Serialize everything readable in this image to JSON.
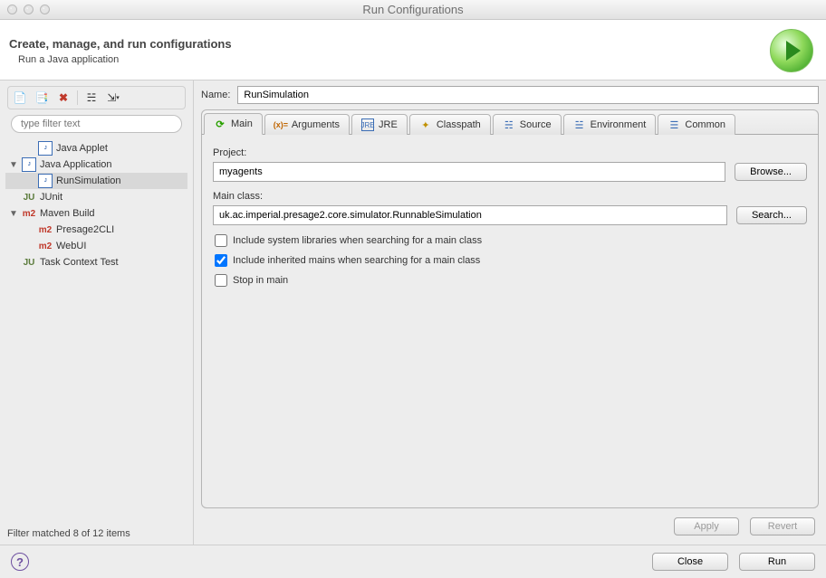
{
  "window": {
    "title": "Run Configurations"
  },
  "header": {
    "title": "Create, manage, and run configurations",
    "subtitle": "Run a Java application"
  },
  "sidebar": {
    "filter_placeholder": "type filter text",
    "status": "Filter matched 8 of 12 items",
    "items": [
      {
        "label": "Java Applet",
        "icon": "java",
        "level": 1,
        "expander": ""
      },
      {
        "label": "Java Application",
        "icon": "java",
        "level": 0,
        "expander": "▼"
      },
      {
        "label": "RunSimulation",
        "icon": "java",
        "level": 1,
        "selected": true,
        "expander": ""
      },
      {
        "label": "JUnit",
        "icon": "junit",
        "level": 0,
        "expander": ""
      },
      {
        "label": "Maven Build",
        "icon": "m2",
        "level": 0,
        "expander": "▼"
      },
      {
        "label": "Presage2CLI",
        "icon": "m2",
        "level": 1,
        "expander": ""
      },
      {
        "label": "WebUI",
        "icon": "m2",
        "level": 1,
        "expander": ""
      },
      {
        "label": "Task Context Test",
        "icon": "junit",
        "level": 0,
        "expander": ""
      }
    ]
  },
  "name": {
    "label": "Name:",
    "value": "RunSimulation"
  },
  "tabs": [
    {
      "label": "Main",
      "icon": "main",
      "active": true
    },
    {
      "label": "Arguments",
      "icon": "args"
    },
    {
      "label": "JRE",
      "icon": "jre"
    },
    {
      "label": "Classpath",
      "icon": "cp"
    },
    {
      "label": "Source",
      "icon": "src"
    },
    {
      "label": "Environment",
      "icon": "env"
    },
    {
      "label": "Common",
      "icon": "com"
    }
  ],
  "main_tab": {
    "project_label": "Project:",
    "project_value": "myagents",
    "browse_label": "Browse...",
    "mainclass_label": "Main class:",
    "mainclass_value": "uk.ac.imperial.presage2.core.simulator.RunnableSimulation",
    "search_label": "Search...",
    "cb1": {
      "label": "Include system libraries when searching for a main class",
      "checked": false
    },
    "cb2": {
      "label": "Include inherited mains when searching for a main class",
      "checked": true
    },
    "cb3": {
      "label": "Stop in main",
      "checked": false
    }
  },
  "buttons": {
    "apply": "Apply",
    "revert": "Revert",
    "close": "Close",
    "run": "Run"
  }
}
